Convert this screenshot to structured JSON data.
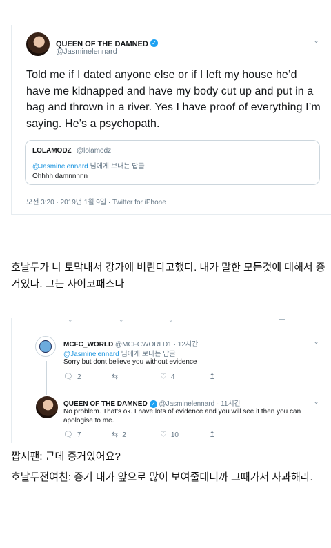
{
  "tweet1": {
    "name": "QUEEN OF THE DAMNED",
    "handle": "@Jasminelennard",
    "body": "Told me if I dated anyone else or if I left my house he’d have me kidnapped and have my body cut up and put in a bag and thrown in a river. Yes I have proof of everything I’m saying. He’s a psychopath.",
    "quote": {
      "name": "LOLAMODZ",
      "handle": "@lolamodz",
      "reply_to": "@Jasminelennard",
      "reply_suffix": " 님에게 보내는 답글",
      "text": "Ohhhh damnnnnn"
    },
    "timestamp": "오전 3:20 · 2019년 1월 9일 · Twitter for iPhone"
  },
  "caption1": "호날두가 나 토막내서 강가에 버린다고했다. 내가 말한 모든것에 대해서 증거있다. 그는 사이코패스다",
  "tweet2": {
    "name": "MCFC_WORLD",
    "handle_time": "@MCFCWORLD1 · 12시간",
    "reply_to": "@Jasminelennard",
    "reply_suffix": " 님에게 보내는 답글",
    "text": "Sorry but dont believe you without evidence",
    "replies": "2",
    "retweets": "",
    "likes": "4"
  },
  "tweet3": {
    "name": "QUEEN OF THE DAMNED",
    "handle": "@Jasminelennard",
    "time": " · 11시간",
    "text": "No problem. That's ok. I have lots of evidence and you will see it then you can apologise to me.",
    "replies": "7",
    "retweets": "2",
    "likes": "10"
  },
  "caption2": "짭시팬: 근데 증거있어요?",
  "caption3": "호날두전여친: 증거 내가 앞으로 많이 보여줄테니까 그때가서 사과해라.",
  "icons": {
    "verified": "verified-badge-icon",
    "chevron": "chevron-down-icon",
    "reply": "reply-icon",
    "retweet": "retweet-icon",
    "like": "heart-icon",
    "share": "share-icon"
  },
  "colors": {
    "twitter_blue": "#1da1f2",
    "link_blue": "#1b95e0",
    "secondary_text": "#657786",
    "border": "#e6ecf0"
  }
}
